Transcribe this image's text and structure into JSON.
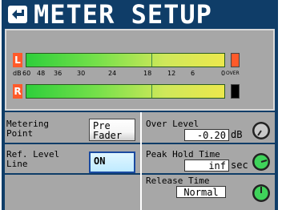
{
  "header": {
    "title": "METER SETUP",
    "back_icon": "return-arrow-icon"
  },
  "meters": {
    "channels": [
      {
        "label": "L",
        "label_color": "#ff5a2a",
        "level_fraction": 1.0,
        "over": true,
        "over_color": "#ff5a2a"
      },
      {
        "label": "R",
        "label_color": "#ff5a2a",
        "level_fraction": 1.0,
        "over": false,
        "over_color": "#000000"
      }
    ],
    "scale_unit": "dB",
    "scale_ticks": [
      "60",
      "48",
      "36",
      "30",
      "24",
      "18",
      "12",
      "6",
      "0"
    ],
    "over_label": "OVER"
  },
  "settings": {
    "metering_point": {
      "label": "Metering\nPoint",
      "value": "Pre\nFader"
    },
    "ref_level_line": {
      "label": "Ref. Level\nLine",
      "value": "ON"
    },
    "over_level": {
      "label": "Over Level",
      "value": "-0.20",
      "unit": "dB",
      "knob_color": "#c9c9c9"
    },
    "peak_hold_time": {
      "label": "Peak Hold Time",
      "value": "inf",
      "unit": "sec",
      "knob_color": "#3fd35a"
    },
    "release_time": {
      "label": "Release Time",
      "value": "Normal",
      "knob_color": "#3fd35a"
    }
  },
  "colors": {
    "background": "#0f3d68",
    "panel": "#a7a7a7",
    "selected_button": "#bfeaff",
    "green_knob": "#3fd35a"
  }
}
